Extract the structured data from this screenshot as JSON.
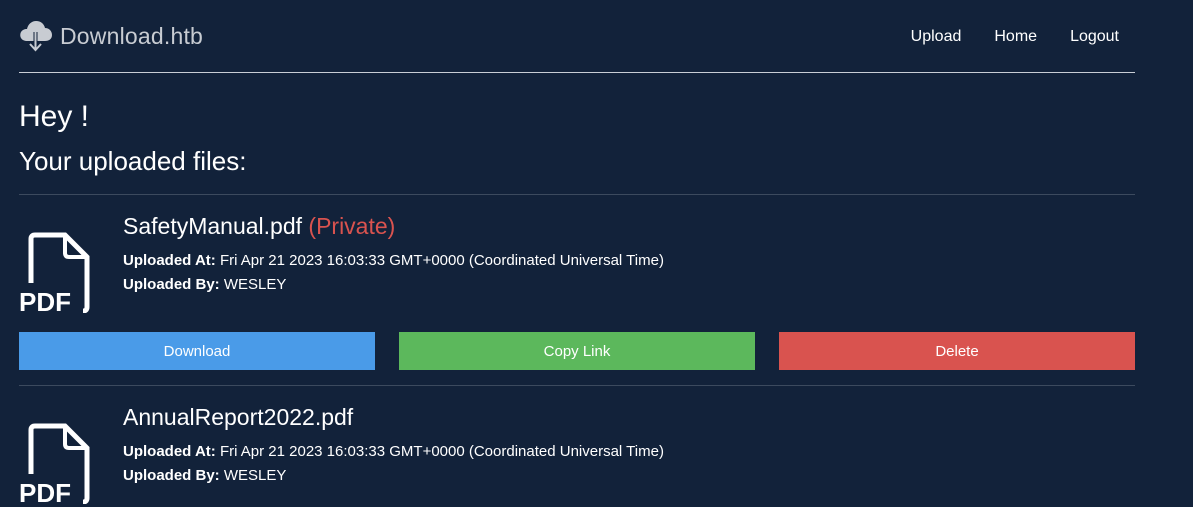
{
  "brand": {
    "name": "Download.htb",
    "icon": "cloud-download-icon"
  },
  "nav": {
    "upload": "Upload",
    "home": "Home",
    "logout": "Logout"
  },
  "greeting": "Hey !",
  "subtitle": "Your uploaded files:",
  "labels": {
    "uploaded_at": "Uploaded At:",
    "uploaded_by": "Uploaded By:"
  },
  "files": [
    {
      "name": "SafetyManual.pdf",
      "visibility": "(Private)",
      "uploaded_at": "Fri Apr 21 2023 16:03:33 GMT+0000 (Coordinated Universal Time)",
      "uploaded_by": "WESLEY",
      "icon_label": "PDF",
      "actions": {
        "download": "Download",
        "copy_link": "Copy Link",
        "delete": "Delete"
      }
    },
    {
      "name": "AnnualReport2022.pdf",
      "visibility": "",
      "uploaded_at": "Fri Apr 21 2023 16:03:33 GMT+0000 (Coordinated Universal Time)",
      "uploaded_by": "WESLEY",
      "icon_label": "PDF"
    }
  ],
  "colors": {
    "background": "#12223a",
    "download": "#4a9be8",
    "copy_link": "#5cb85c",
    "delete": "#d9534f",
    "private": "#d9534f"
  }
}
